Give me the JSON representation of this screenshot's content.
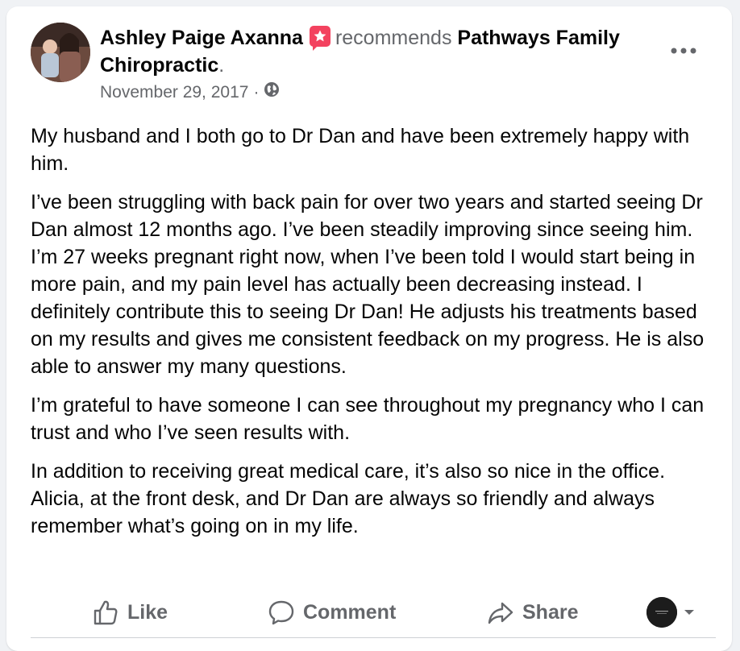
{
  "post": {
    "author": "Ashley Paige Axanna",
    "verb": "recommends",
    "page_name": "Pathways Family Chiropractic",
    "page_suffix": ".",
    "date": "November 29, 2017",
    "separator": "·",
    "audience_icon": "globe-icon",
    "more_icon": "more-options-icon",
    "paragraphs": [
      "My husband and I both go to Dr Dan and have been extremely happy with him.",
      "I’ve been struggling with back pain for over two years and started seeing Dr Dan almost 12 months ago. I’ve been steadily improving since seeing him. I’m 27 weeks pregnant right now, when I’ve been told I would start being in more pain, and my pain level has actually been decreasing instead. I definitely contribute this to seeing Dr Dan! He adjusts his treatments based on my results and gives me consistent feedback on my progress. He is also able to answer my many questions.",
      "I’m grateful to have someone I can see throughout my pregnancy who I can trust and who I’ve seen results with.",
      "In addition to receiving great medical care, it’s also so nice in the office. Alicia, at the front desk, and Dr Dan are always so friendly and always remember what’s going on in my life."
    ]
  },
  "actions": {
    "like_label": "Like",
    "comment_label": "Comment",
    "share_label": "Share"
  },
  "colors": {
    "background": "#f0f2f5",
    "card": "#ffffff",
    "primary_text": "#050505",
    "secondary_text": "#65676b",
    "recommend_badge": "#f3425f",
    "divider": "#ced0d4"
  }
}
